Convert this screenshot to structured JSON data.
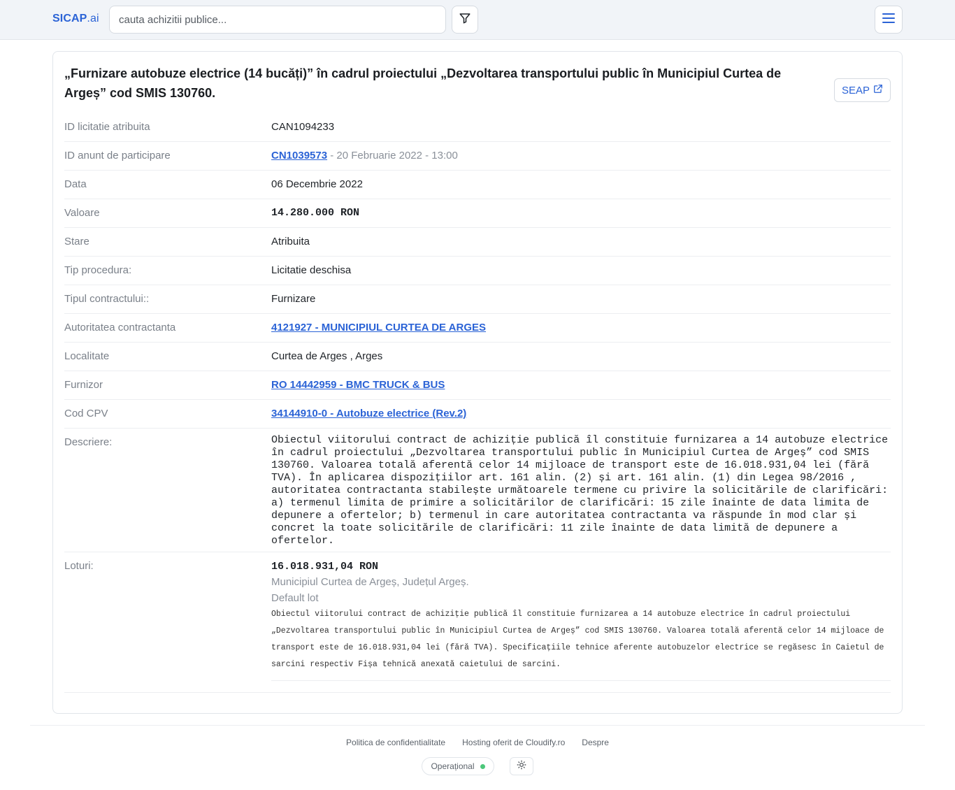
{
  "header": {
    "brand_main": "SICAP",
    "brand_suffix": ".ai",
    "search_placeholder": "cauta achizitii publice..."
  },
  "icons": {
    "filter": "filter-icon",
    "menu": "hamburger-menu-icon",
    "external_link": "external-link-icon",
    "theme": "sun-icon"
  },
  "colors": {
    "accent": "#2b63d6",
    "status_ok": "#4cc77a"
  },
  "card": {
    "title": "„Furnizare autobuze electrice (14 bucăți)” în cadrul proiectului „Dezvoltarea transportului public în Municipiul Curtea de Argeș” cod SMIS 130760.",
    "seap_label": "SEAP"
  },
  "details": {
    "id_atribuita": {
      "label": "ID licitatie atribuita",
      "value": "CAN1094233"
    },
    "id_anunt": {
      "label": "ID anunt de participare",
      "link": "CN1039573",
      "extra": " - 20 Februarie 2022 - 13:00"
    },
    "data": {
      "label": "Data",
      "value": "06 Decembrie 2022"
    },
    "valoare": {
      "label": "Valoare",
      "value": "14.280.000 RON"
    },
    "stare": {
      "label": "Stare",
      "value": "Atribuita"
    },
    "tip_procedura": {
      "label": "Tip procedura:",
      "value": "Licitatie deschisa"
    },
    "tip_contract": {
      "label": "Tipul contractului::",
      "value": "Furnizare"
    },
    "autoritate": {
      "label": "Autoritatea contractanta",
      "link": "4121927 - MUNICIPIUL CURTEA DE ARGES"
    },
    "localitate": {
      "label": "Localitate",
      "value": "Curtea de Arges , Arges"
    },
    "furnizor": {
      "label": "Furnizor",
      "link": "RO 14442959 - BMC TRUCK & BUS"
    },
    "cpv": {
      "label": "Cod CPV",
      "link": "34144910-0 - Autobuze electrice (Rev.2)"
    },
    "descriere": {
      "label": "Descriere:",
      "value": "Obiectul viitorului contract de achiziție publică îl constituie furnizarea a 14 autobuze electrice în cadrul proiectului „Dezvoltarea transportului public în Municipiul Curtea de Argeș” cod SMIS 130760. Valoarea totală aferentă celor 14 mijloace de transport este de 16.018.931,04 lei (fără TVA). În aplicarea dispozițiilor art. 161 alin. (2) și art. 161 alin. (1) din Legea 98/2016 , autoritatea contractanta stabilește următoarele termene cu privire la solicitările de clarificări: a) termenul limita de primire a solicitărilor de clarificări: 15 zile înainte de data limita de depunere a ofertelor; b) termenul in care autoritatea contractanta va răspunde în mod clar și concret la toate solicitările de clarificări: 11 zile înainte de data limită de depunere a ofertelor."
    },
    "loturi": {
      "label": "Loturi:",
      "value": "16.018.931,04 RON",
      "place": "Municipiul Curtea de Argeș, Județul Argeș.",
      "name": "Default lot",
      "description": "Obiectul viitorului contract de achiziție publică îl constituie furnizarea a 14 autobuze electrice în cadrul proiectului „Dezvoltarea transportului public în Municipiul Curtea de Argeș” cod SMIS 130760. Valoarea totală aferentă celor 14 mijloace de transport este de 16.018.931,04 lei (fără TVA). Specificațiile tehnice aferente autobuzelor electrice se regăsesc în Caietul de sarcini respectiv Fișa tehnică anexată caietului de sarcini."
    }
  },
  "footer": {
    "links": [
      "Politica de confidentialitate",
      "Hosting oferit de Cloudify.ro",
      "Despre"
    ],
    "status_label": "Operațional"
  }
}
